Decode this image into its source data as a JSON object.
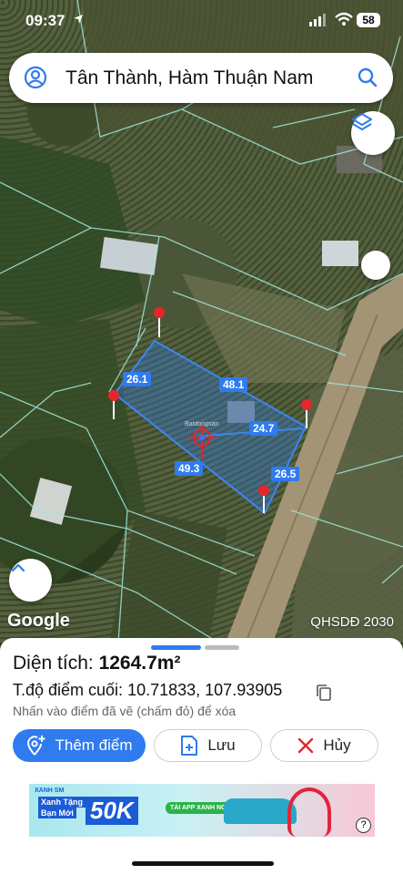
{
  "status_bar": {
    "time": "09:37",
    "battery": "58"
  },
  "search": {
    "query": "Tân Thành, Hàm Thuận Nam"
  },
  "map": {
    "google_label": "Google",
    "layer_label": "QHSDĐ 2030",
    "edge_lengths": [
      "26.1",
      "48.1",
      "24.7",
      "49.3",
      "26.5"
    ],
    "watermark": "Batdongsan"
  },
  "panel": {
    "area_label": "Diện tích:",
    "area_value": "1264.7m²",
    "coord_label": "T.độ điểm cuối:",
    "coord_value": "10.71833, 107.93905",
    "hint": "Nhấn vào điểm đã vẽ (chấm đỏ) để xóa",
    "buttons": {
      "add_point": "Thêm điểm",
      "save": "Lưu",
      "cancel": "Hủy"
    }
  },
  "ad": {
    "brand": "XANH SM",
    "line1": "Xanh Tặng",
    "line2": "Bạn Mới",
    "amount": "50K",
    "cta": "TẢI APP XANH NGAY"
  },
  "colors": {
    "accent": "#2f7bef",
    "plot_line": "#9fe7d9",
    "pin": "#e5262b"
  }
}
